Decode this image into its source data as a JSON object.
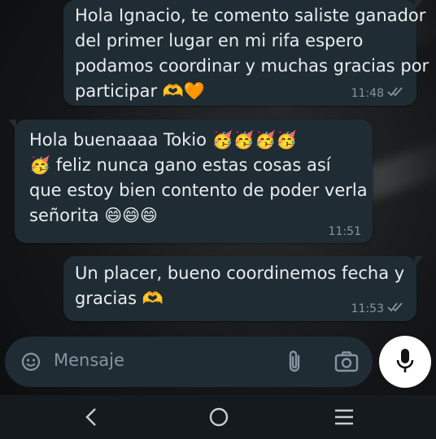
{
  "messages": [
    {
      "direction": "outgoing",
      "lines": [
        "Hola Ignacio, te comento saliste ganador",
        "del primer lugar en mi rifa espero",
        "podamos coordinar y muchas gracias por",
        "participar 🫶🧡"
      ],
      "time": "11:48",
      "status": "read"
    },
    {
      "direction": "incoming",
      "lines": [
        "Hola buenaaaa Tokio 🥳🥳🥳🥳",
        "🥳 feliz nunca gano estas cosas así",
        "que estoy bien contento de poder verla",
        "señorita 😄😄😄"
      ],
      "time": "11:51"
    },
    {
      "direction": "outgoing",
      "lines": [
        "Un placer, bueno coordinemos fecha y",
        "gracias 🫶"
      ],
      "time": "11:53",
      "status": "read"
    }
  ],
  "composer": {
    "placeholder": "Mensaje",
    "icons": [
      "sticker-icon",
      "attach-icon",
      "camera-icon"
    ],
    "send_icon": "mic-icon"
  },
  "navbar": {
    "icons": [
      "back-icon",
      "home-icon",
      "recents-icon"
    ]
  },
  "colors": {
    "bubble": "#1f2c33",
    "text": "#e9edef",
    "meta": "#8696a0",
    "mic_bg": "#ffffff"
  }
}
